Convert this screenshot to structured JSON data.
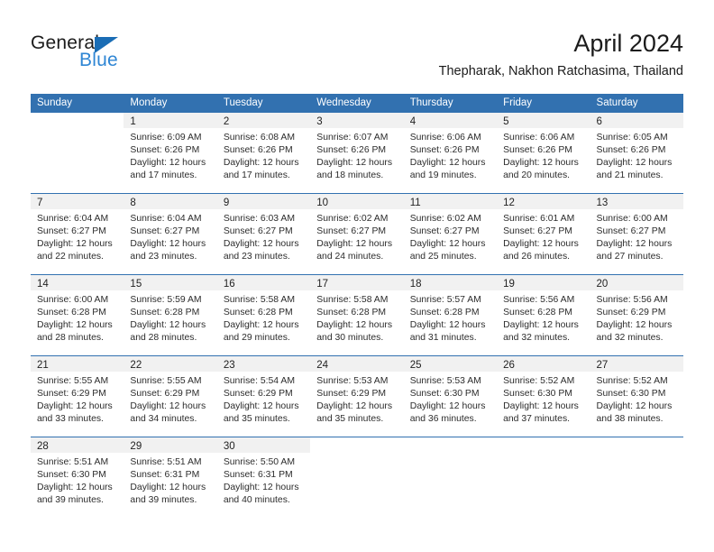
{
  "brand": {
    "name_top": "General",
    "name_bottom": "Blue",
    "triangle_icon": "triangle-icon",
    "color_top": "#1b1b1b",
    "color_bottom": "#2f86d4",
    "triangle_color": "#1a6db5"
  },
  "header": {
    "month_title": "April 2024",
    "location": "Thepharak, Nakhon Ratchasima, Thailand"
  },
  "theme": {
    "header_blue": "#3271b0",
    "band_gray": "#f1f1f1",
    "text": "#2c2c2c"
  },
  "calendar": {
    "weekdays": [
      "Sunday",
      "Monday",
      "Tuesday",
      "Wednesday",
      "Thursday",
      "Friday",
      "Saturday"
    ],
    "weeks": [
      [
        {
          "day": "",
          "lines": []
        },
        {
          "day": "1",
          "lines": [
            "Sunrise: 6:09 AM",
            "Sunset: 6:26 PM",
            "Daylight: 12 hours",
            "and 17 minutes."
          ]
        },
        {
          "day": "2",
          "lines": [
            "Sunrise: 6:08 AM",
            "Sunset: 6:26 PM",
            "Daylight: 12 hours",
            "and 17 minutes."
          ]
        },
        {
          "day": "3",
          "lines": [
            "Sunrise: 6:07 AM",
            "Sunset: 6:26 PM",
            "Daylight: 12 hours",
            "and 18 minutes."
          ]
        },
        {
          "day": "4",
          "lines": [
            "Sunrise: 6:06 AM",
            "Sunset: 6:26 PM",
            "Daylight: 12 hours",
            "and 19 minutes."
          ]
        },
        {
          "day": "5",
          "lines": [
            "Sunrise: 6:06 AM",
            "Sunset: 6:26 PM",
            "Daylight: 12 hours",
            "and 20 minutes."
          ]
        },
        {
          "day": "6",
          "lines": [
            "Sunrise: 6:05 AM",
            "Sunset: 6:26 PM",
            "Daylight: 12 hours",
            "and 21 minutes."
          ]
        }
      ],
      [
        {
          "day": "7",
          "lines": [
            "Sunrise: 6:04 AM",
            "Sunset: 6:27 PM",
            "Daylight: 12 hours",
            "and 22 minutes."
          ]
        },
        {
          "day": "8",
          "lines": [
            "Sunrise: 6:04 AM",
            "Sunset: 6:27 PM",
            "Daylight: 12 hours",
            "and 23 minutes."
          ]
        },
        {
          "day": "9",
          "lines": [
            "Sunrise: 6:03 AM",
            "Sunset: 6:27 PM",
            "Daylight: 12 hours",
            "and 23 minutes."
          ]
        },
        {
          "day": "10",
          "lines": [
            "Sunrise: 6:02 AM",
            "Sunset: 6:27 PM",
            "Daylight: 12 hours",
            "and 24 minutes."
          ]
        },
        {
          "day": "11",
          "lines": [
            "Sunrise: 6:02 AM",
            "Sunset: 6:27 PM",
            "Daylight: 12 hours",
            "and 25 minutes."
          ]
        },
        {
          "day": "12",
          "lines": [
            "Sunrise: 6:01 AM",
            "Sunset: 6:27 PM",
            "Daylight: 12 hours",
            "and 26 minutes."
          ]
        },
        {
          "day": "13",
          "lines": [
            "Sunrise: 6:00 AM",
            "Sunset: 6:27 PM",
            "Daylight: 12 hours",
            "and 27 minutes."
          ]
        }
      ],
      [
        {
          "day": "14",
          "lines": [
            "Sunrise: 6:00 AM",
            "Sunset: 6:28 PM",
            "Daylight: 12 hours",
            "and 28 minutes."
          ]
        },
        {
          "day": "15",
          "lines": [
            "Sunrise: 5:59 AM",
            "Sunset: 6:28 PM",
            "Daylight: 12 hours",
            "and 28 minutes."
          ]
        },
        {
          "day": "16",
          "lines": [
            "Sunrise: 5:58 AM",
            "Sunset: 6:28 PM",
            "Daylight: 12 hours",
            "and 29 minutes."
          ]
        },
        {
          "day": "17",
          "lines": [
            "Sunrise: 5:58 AM",
            "Sunset: 6:28 PM",
            "Daylight: 12 hours",
            "and 30 minutes."
          ]
        },
        {
          "day": "18",
          "lines": [
            "Sunrise: 5:57 AM",
            "Sunset: 6:28 PM",
            "Daylight: 12 hours",
            "and 31 minutes."
          ]
        },
        {
          "day": "19",
          "lines": [
            "Sunrise: 5:56 AM",
            "Sunset: 6:28 PM",
            "Daylight: 12 hours",
            "and 32 minutes."
          ]
        },
        {
          "day": "20",
          "lines": [
            "Sunrise: 5:56 AM",
            "Sunset: 6:29 PM",
            "Daylight: 12 hours",
            "and 32 minutes."
          ]
        }
      ],
      [
        {
          "day": "21",
          "lines": [
            "Sunrise: 5:55 AM",
            "Sunset: 6:29 PM",
            "Daylight: 12 hours",
            "and 33 minutes."
          ]
        },
        {
          "day": "22",
          "lines": [
            "Sunrise: 5:55 AM",
            "Sunset: 6:29 PM",
            "Daylight: 12 hours",
            "and 34 minutes."
          ]
        },
        {
          "day": "23",
          "lines": [
            "Sunrise: 5:54 AM",
            "Sunset: 6:29 PM",
            "Daylight: 12 hours",
            "and 35 minutes."
          ]
        },
        {
          "day": "24",
          "lines": [
            "Sunrise: 5:53 AM",
            "Sunset: 6:29 PM",
            "Daylight: 12 hours",
            "and 35 minutes."
          ]
        },
        {
          "day": "25",
          "lines": [
            "Sunrise: 5:53 AM",
            "Sunset: 6:30 PM",
            "Daylight: 12 hours",
            "and 36 minutes."
          ]
        },
        {
          "day": "26",
          "lines": [
            "Sunrise: 5:52 AM",
            "Sunset: 6:30 PM",
            "Daylight: 12 hours",
            "and 37 minutes."
          ]
        },
        {
          "day": "27",
          "lines": [
            "Sunrise: 5:52 AM",
            "Sunset: 6:30 PM",
            "Daylight: 12 hours",
            "and 38 minutes."
          ]
        }
      ],
      [
        {
          "day": "28",
          "lines": [
            "Sunrise: 5:51 AM",
            "Sunset: 6:30 PM",
            "Daylight: 12 hours",
            "and 39 minutes."
          ]
        },
        {
          "day": "29",
          "lines": [
            "Sunrise: 5:51 AM",
            "Sunset: 6:31 PM",
            "Daylight: 12 hours",
            "and 39 minutes."
          ]
        },
        {
          "day": "30",
          "lines": [
            "Sunrise: 5:50 AM",
            "Sunset: 6:31 PM",
            "Daylight: 12 hours",
            "and 40 minutes."
          ]
        },
        {
          "day": "",
          "lines": []
        },
        {
          "day": "",
          "lines": []
        },
        {
          "day": "",
          "lines": []
        },
        {
          "day": "",
          "lines": []
        }
      ]
    ]
  }
}
